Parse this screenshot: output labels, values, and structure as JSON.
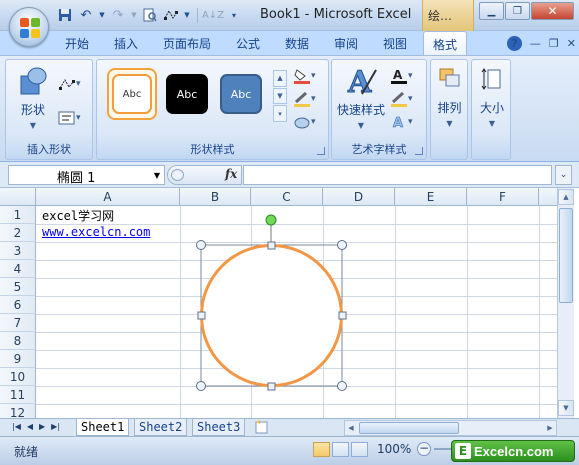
{
  "window": {
    "title": "Book1 - Microsoft Excel",
    "context_title": "绘…"
  },
  "ribbon_tabs": [
    {
      "label": "开始"
    },
    {
      "label": "插入"
    },
    {
      "label": "页面布局"
    },
    {
      "label": "公式"
    },
    {
      "label": "数据"
    },
    {
      "label": "审阅"
    },
    {
      "label": "视图"
    },
    {
      "label": "格式",
      "active": true
    }
  ],
  "ribbon": {
    "groups": {
      "insert_shapes": {
        "label": "插入形状",
        "shapes_button": "形状"
      },
      "shape_styles": {
        "label": "形状样式",
        "swatches": [
          {
            "label": "Abc",
            "bg": "#ffffff",
            "border": "#f39c3c",
            "fg": "#333333"
          },
          {
            "label": "Abc",
            "bg": "#000000",
            "border": "#000000",
            "fg": "#ffffff"
          },
          {
            "label": "Abc",
            "bg": "#4f81bd",
            "border": "#385d8a",
            "fg": "#ffffff"
          }
        ]
      },
      "wordart": {
        "label": "艺术字样式",
        "quick_styles": "快速样式"
      },
      "arrange": {
        "label": "排列"
      },
      "size": {
        "label": "大小"
      }
    }
  },
  "formula_bar": {
    "name_box": "椭圆 1",
    "fx_label": "fx",
    "formula": ""
  },
  "sheet": {
    "columns": [
      "A",
      "B",
      "C",
      "D",
      "E",
      "F"
    ],
    "rows": [
      "1",
      "2",
      "3",
      "4",
      "5",
      "6",
      "7",
      "8",
      "9",
      "10",
      "11",
      "12"
    ],
    "cells": {
      "A1": "excel学习网",
      "A2": "www.excelcn.com"
    },
    "shape": {
      "type": "oval",
      "name": "椭圆 1",
      "outline_color": "#f39645",
      "fill_color": "#ffffff"
    }
  },
  "sheet_tabs": [
    {
      "label": "Sheet1",
      "active": true
    },
    {
      "label": "Sheet2"
    },
    {
      "label": "Sheet3"
    }
  ],
  "status_bar": {
    "status": "就绪",
    "zoom": "100%"
  },
  "watermark": {
    "logo": "E",
    "text": "Excelcn.com"
  }
}
